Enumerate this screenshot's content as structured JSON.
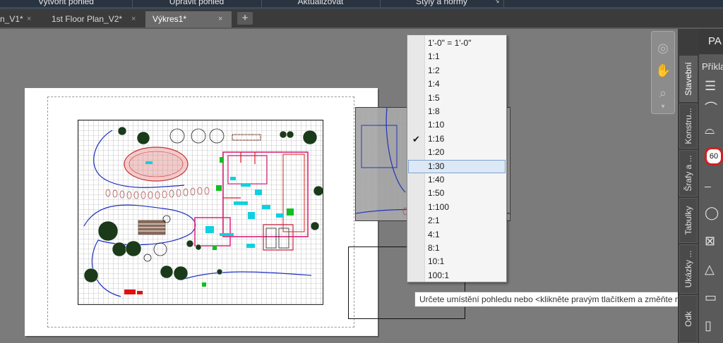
{
  "ribbon": {
    "items": [
      "Vytvořit pohled",
      "Upravit pohled",
      "Aktualizovat",
      "Styly a normy"
    ]
  },
  "tabs": [
    {
      "label": "n_V1*"
    },
    {
      "label": "1st Floor Plan_V2*"
    },
    {
      "label": "Výkres1*"
    }
  ],
  "add_tab_label": "+",
  "close_glyph": "×",
  "scale_menu": {
    "items": [
      "1'-0\" = 1'-0\"",
      "1:1",
      "1:2",
      "1:4",
      "1:5",
      "1:8",
      "1:10",
      "1:16",
      "1:20",
      "1:30",
      "1:40",
      "1:50",
      "1:100",
      "2:1",
      "4:1",
      "8:1",
      "10:1",
      "100:1"
    ],
    "checked": "1:16",
    "highlighted": "1:30",
    "check_glyph": "✔"
  },
  "tooltip": "Určete umístění pohledu nebo <klikněte pravým tlačítkem a změňte měřítko>:",
  "tool_palette": {
    "title": "PA",
    "subtitle": "Příkla",
    "tabs": [
      "Stavební",
      "Konstru...",
      "Šrafy a ...",
      "Tabulky",
      "Ukázky ...",
      "Odk"
    ],
    "active_tab": "Stavební",
    "badge_value": "60"
  },
  "colors": {
    "ribbon_bg": "#2a3340",
    "canvas_bg": "#7b7b7b",
    "menu_highlight": "#dce8f5",
    "plan_blue": "#1f2fbf",
    "plan_magenta": "#e0207a",
    "plan_cyan": "#10d0e0",
    "plan_green": "#10c020"
  },
  "icons": [
    "close-icon",
    "plus-icon",
    "checkmark-icon",
    "pan-hand-icon",
    "steering-wheel-icon",
    "zoom-icon",
    "orbit-icon"
  ]
}
